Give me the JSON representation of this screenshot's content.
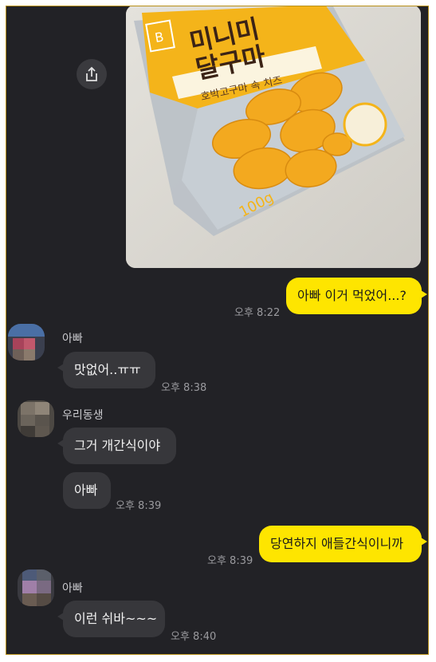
{
  "photo": {
    "brand_logo": "B",
    "title_line1": "미니미",
    "title_line2": "달구마",
    "subtitle": "호박고구마 속 치즈",
    "weight": "100g"
  },
  "messages": [
    {
      "text": "아빠 이거 먹었어...?",
      "time": "오후 8:22"
    },
    {
      "sender": "아빠",
      "text": "맛없어..ㅠㅠ",
      "time": "오후 8:38"
    },
    {
      "sender": "우리동생",
      "text": "그거 개간식이야"
    },
    {
      "text": "아빠",
      "time": "오후 8:39"
    },
    {
      "text": "당연하지 애들간식이니까",
      "time": "오후 8:39"
    },
    {
      "sender": "아빠",
      "text": "이런 쉬바~~~",
      "time": "오후 8:40"
    }
  ],
  "colors": {
    "my_bubble": "#fee500",
    "their_bubble": "#37373b",
    "background": "#222226"
  },
  "icons": {
    "share": "share-icon"
  }
}
